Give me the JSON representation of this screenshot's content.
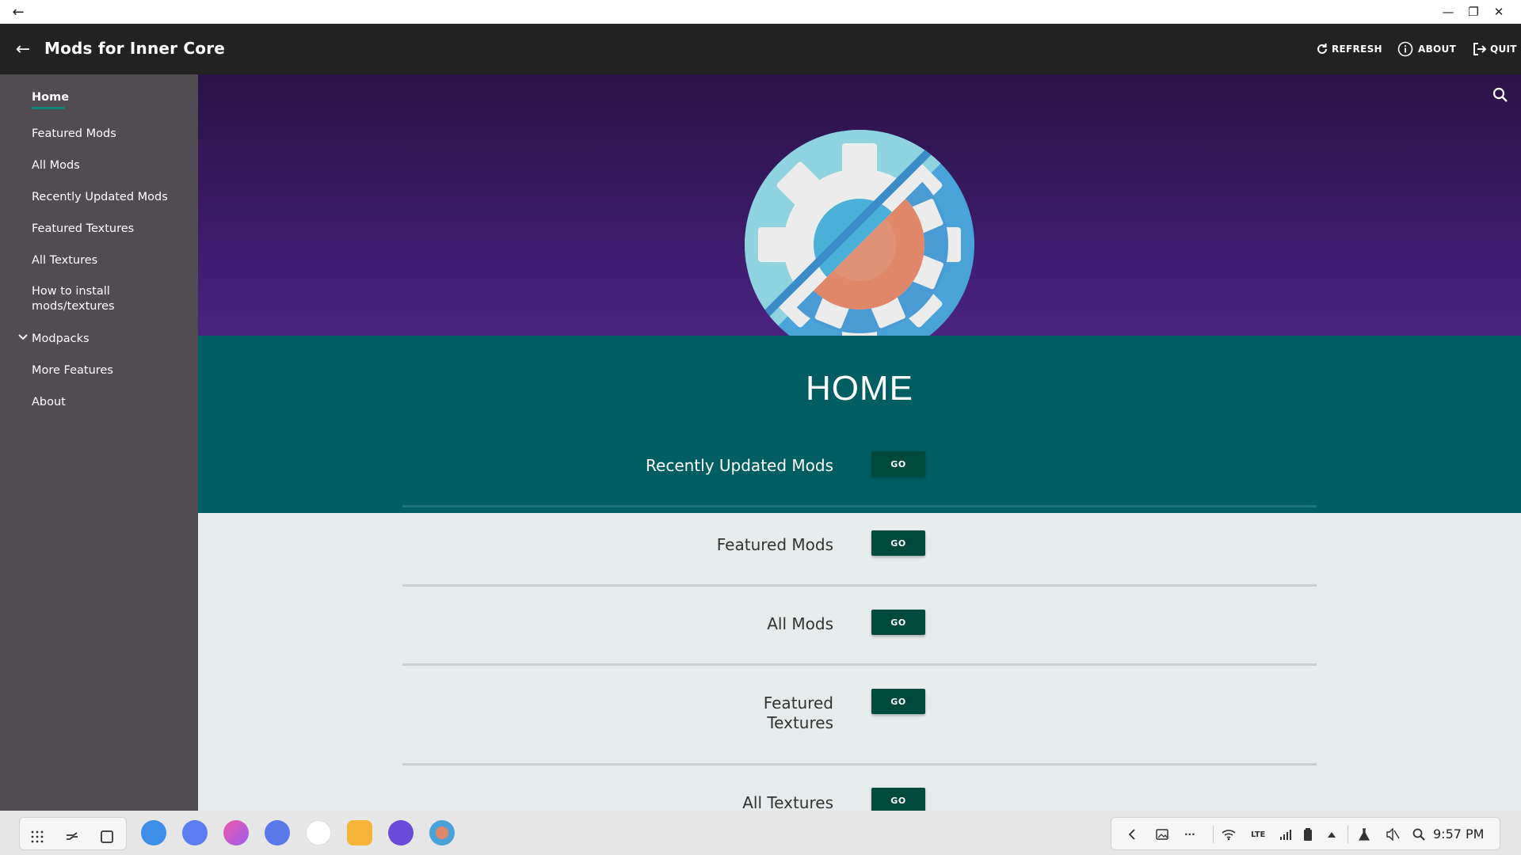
{
  "window": {
    "back_glyph": "←",
    "minimize_glyph": "—",
    "restore_glyph": "❐",
    "close_glyph": "✕"
  },
  "appbar": {
    "title": "Mods for Inner Core",
    "back_glyph": "←",
    "actions": [
      {
        "label": "REFRESH",
        "icon": "refresh-icon"
      },
      {
        "label": "ABOUT",
        "icon": "info-icon"
      },
      {
        "label": "QUIT",
        "icon": "exit-icon"
      }
    ]
  },
  "sidebar": {
    "items": [
      {
        "label": "Home",
        "active": true
      },
      {
        "label": "Featured Mods"
      },
      {
        "label": "All Mods"
      },
      {
        "label": "Recently Updated Mods"
      },
      {
        "label": "Featured Textures"
      },
      {
        "label": "All Textures"
      },
      {
        "label": "How to install",
        "label2": "mods/textures"
      },
      {
        "label": "Modpacks",
        "expandable": true,
        "chevron": "⌄"
      },
      {
        "label": "More Features"
      },
      {
        "label": "About"
      }
    ]
  },
  "main": {
    "page_title": "HOME",
    "rows": [
      {
        "label": "Recently Updated Mods",
        "button": "GO"
      },
      {
        "label": "Featured Mods",
        "button": "GO"
      },
      {
        "label": "All Mods",
        "button": "GO"
      },
      {
        "label": "Featured",
        "label2": "Textures",
        "button": "GO"
      },
      {
        "label": "All Textures",
        "button": "GO"
      }
    ]
  },
  "taskbar": {
    "launcher_icons": [
      "apps-grid-icon",
      "recents-icon",
      "home-square-icon"
    ],
    "apps": [
      "cloud-app-icon",
      "screen-capture-app-icon",
      "store-app-icon",
      "settings-app-icon",
      "galaxy-apps-icon",
      "files-app-icon",
      "internet-app-icon",
      "inner-core-app-icon"
    ],
    "system": {
      "dots": "···",
      "network": "LTE",
      "time": "9:57 PM"
    }
  },
  "colors": {
    "appbar": "#222222",
    "sidebar": "#514b52",
    "accent_teal": "#005e62",
    "button": "#004a3d",
    "hero_top": "#2a1346",
    "hero_bottom": "#4a2382"
  }
}
